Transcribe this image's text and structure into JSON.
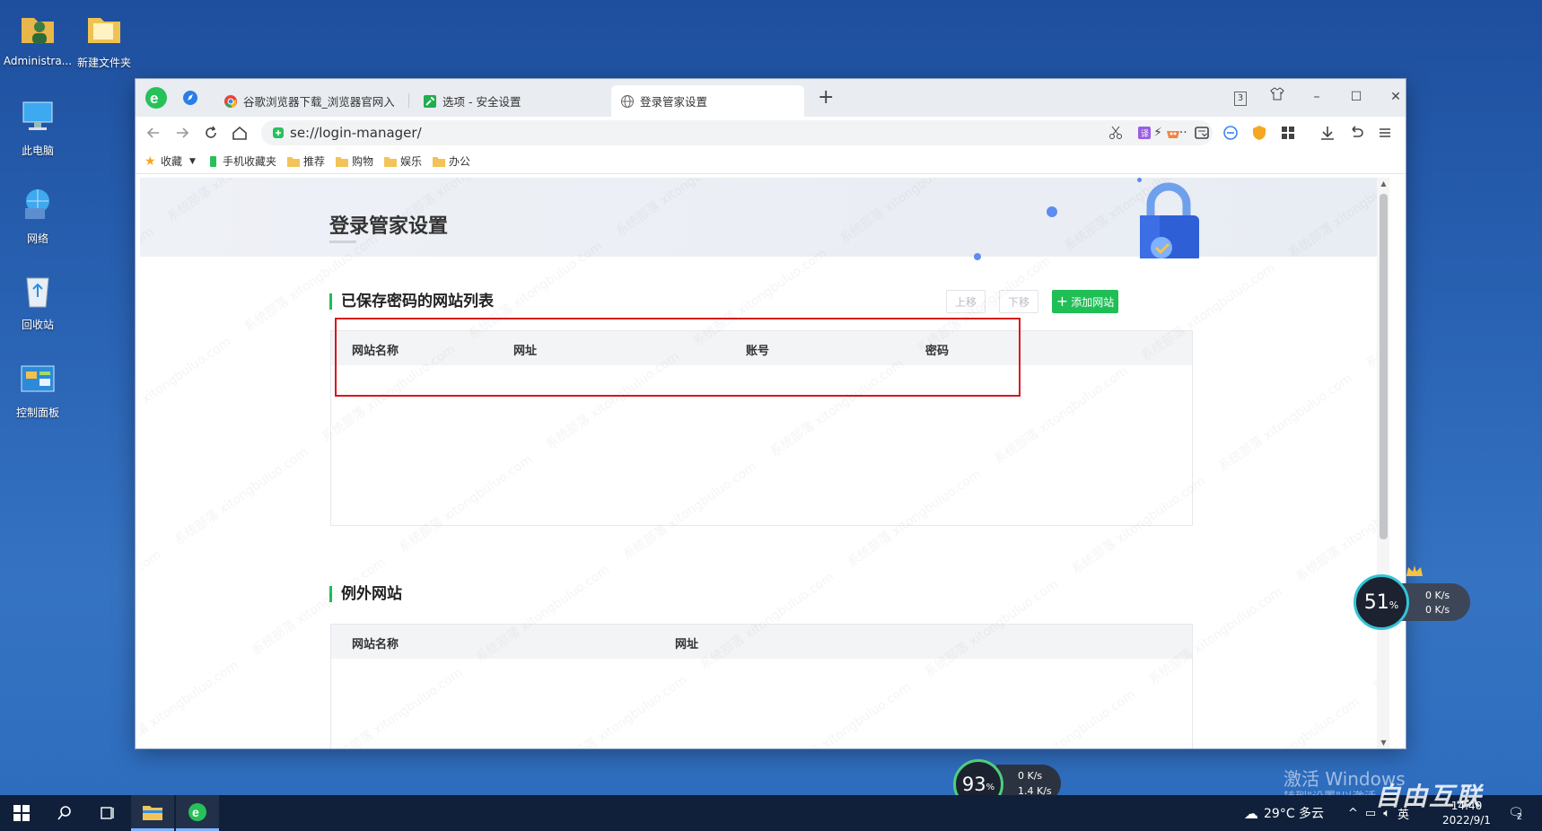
{
  "desktop": {
    "icons": [
      {
        "label": "Administra..."
      },
      {
        "label": "新建文件夹"
      },
      {
        "label": "此电脑"
      },
      {
        "label": "网络"
      },
      {
        "label": "回收站"
      },
      {
        "label": "控制面板"
      }
    ]
  },
  "browser": {
    "tab_count_badge": "3",
    "tabs": [
      {
        "label": "谷歌浏览器下载_浏览器官网入口"
      },
      {
        "label": "选项 - 安全设置"
      },
      {
        "label": "登录管家设置"
      }
    ],
    "new_tab": "+",
    "address": {
      "value": "se://login-manager/"
    },
    "bookmarks": [
      {
        "label": "收藏"
      },
      {
        "label": "手机收藏夹"
      },
      {
        "label": "推荐"
      },
      {
        "label": "购物"
      },
      {
        "label": "娱乐"
      },
      {
        "label": "办公"
      }
    ]
  },
  "page": {
    "title": "登录管家设置",
    "saved": {
      "heading": "已保存密码的网站列表",
      "move_up": "上移",
      "move_down": "下移",
      "add_site": "添加网站",
      "columns": [
        "网站名称",
        "网址",
        "账号",
        "密码"
      ]
    },
    "exceptions": {
      "heading": "例外网站",
      "columns": [
        "网站名称",
        "网址"
      ]
    }
  },
  "widgets": {
    "mem_right": {
      "percent": "51",
      "unit": "%",
      "up": "0 K/s",
      "down": "0 K/s"
    },
    "mem_bottom": {
      "percent": "93",
      "unit": "%",
      "up": "0 K/s",
      "down": "1.4 K/s"
    }
  },
  "overlay": {
    "activate_title": "激活 Windows",
    "activate_sub": "转到\"设置\"以激活",
    "brand": "自由互联"
  },
  "taskbar": {
    "weather": "29°C 多云",
    "ime": "英",
    "time": "14:40",
    "date": "2022/9/1",
    "notification_count": "2"
  },
  "colors": {
    "accent_green": "#1fbf56",
    "highlight_red": "#d9161d"
  }
}
